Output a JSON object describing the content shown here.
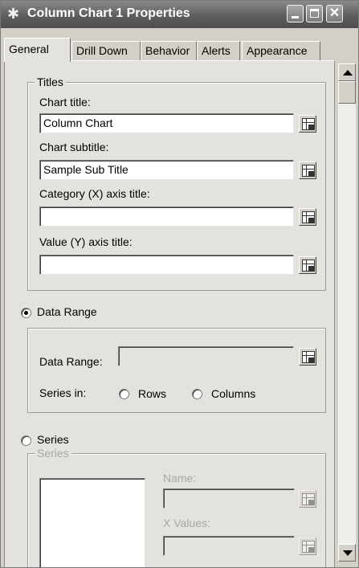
{
  "window": {
    "title": "Column Chart 1 Properties"
  },
  "tabs": [
    {
      "label": "General",
      "active": true
    },
    {
      "label": "Drill Down"
    },
    {
      "label": "Behavior"
    },
    {
      "label": "Alerts"
    },
    {
      "label": "Appearance"
    }
  ],
  "titles": {
    "legend": "Titles",
    "chart_title_label": "Chart title:",
    "chart_title_value": "Column Chart",
    "chart_subtitle_label": "Chart subtitle:",
    "chart_subtitle_value": "Sample Sub Title",
    "category_axis_label": "Category (X) axis title:",
    "category_axis_value": "",
    "value_axis_label": "Value (Y) axis title:",
    "value_axis_value": ""
  },
  "data_range": {
    "option_label": "Data Range",
    "selected": true,
    "field_label": "Data Range:",
    "field_value": "",
    "series_in_label": "Series in:",
    "rows_label": "Rows",
    "columns_label": "Columns"
  },
  "series": {
    "option_label": "Series",
    "selected": false,
    "legend": "Series",
    "name_label": "Name:",
    "name_value": "",
    "x_values_label": "X Values:",
    "x_values_value": ""
  }
}
